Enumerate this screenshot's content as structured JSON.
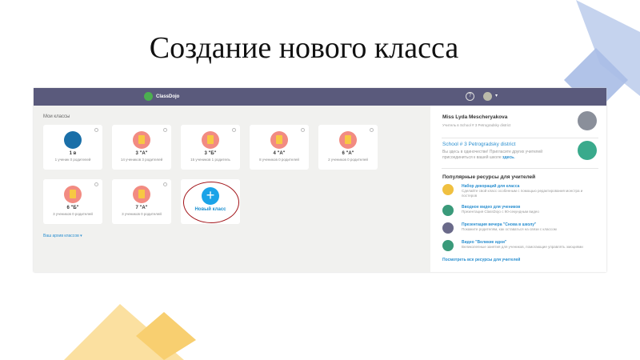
{
  "slide": {
    "title": "Создание нового класса"
  },
  "app": {
    "logo": "ClassDojo",
    "help": "?",
    "my_classes": "Мои классы",
    "archive": "Ваш архив классов ▾",
    "classes": [
      {
        "name": "1 в",
        "stats": "1 ученик 0 родителей",
        "icon": "globe"
      },
      {
        "name": "3 \"А\"",
        "stats": "14 учеников 3 родителей",
        "icon": "notebook"
      },
      {
        "name": "3 \"Б\"",
        "stats": "15 учеников 1 родитель",
        "icon": "notebook"
      },
      {
        "name": "4 \"А\"",
        "stats": "8 учеников 0 родителей",
        "icon": "notebook"
      },
      {
        "name": "6 \"А\"",
        "stats": "2 учеников 0 родителей",
        "icon": "notebook"
      },
      {
        "name": "6 \"Б\"",
        "stats": "3 учеников 0 родителей",
        "icon": "notebook"
      },
      {
        "name": "7 \"А\"",
        "stats": "3 учеников 0 родителей",
        "icon": "notebook"
      }
    ],
    "new_class": "Новый класс"
  },
  "sidebar": {
    "name": "Miss Lyda Mescheryakova",
    "role": "Учитель в School # 3 Petrogradsky district",
    "school": "School # 3 Petrogradsky district",
    "invite": "Вы здесь в одиночестве! Пригласите других учителей присоединиться к вашей школе",
    "invite_link": "здесь.",
    "popular": "Популярные ресурсы для учителей",
    "resources": [
      {
        "title": "Набор декораций для класса",
        "desc": "Сделайте свой класс особенным с помощью редактирования монстра и постеров",
        "color": "#f0c040"
      },
      {
        "title": "Вводное видео для учеников",
        "desc": "Презентация ClassDojo с 90-секундным видео",
        "color": "#3a9a7a"
      },
      {
        "title": "Презентация вечера \"Снова в школу\"",
        "desc": "Покажите родителям, как оставаться на связи с классом",
        "color": "#6a6a8a"
      },
      {
        "title": "Видео \"Великие идеи\"",
        "desc": "Великолепные занятия для учеников, помогающие управлять эмоциями",
        "color": "#3a9a7a"
      }
    ],
    "all": "Посмотреть все ресурсы для учителей"
  }
}
